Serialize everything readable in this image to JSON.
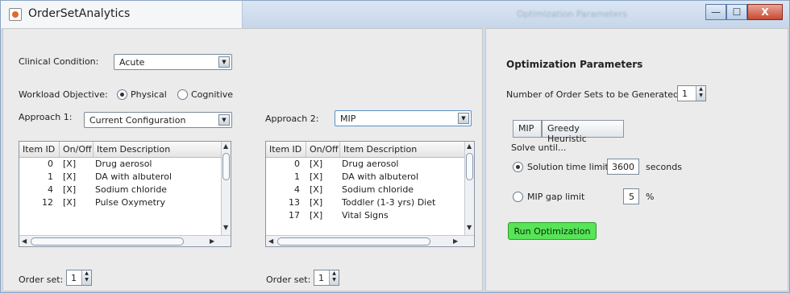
{
  "window": {
    "title": "OrderSetAnalytics",
    "blurred_title": "Optimization Parameters",
    "controls": [
      "—",
      "☐",
      "X"
    ]
  },
  "left": {
    "clinical_condition_label": "Clinical Condition:",
    "clinical_condition_value": "Acute",
    "workload_label": "Workload Objective:",
    "workload_options": [
      "Physical",
      "Cognitive"
    ],
    "workload_selected": "Physical",
    "approach1_label": "Approach 1:",
    "approach1_value": "Current Configuration",
    "approach2_label": "Approach 2:",
    "approach2_value": "MIP",
    "table_headers": [
      "Item ID",
      "On/Off",
      "Item Description"
    ],
    "table1_rows": [
      {
        "id": "0",
        "onoff": "[X]",
        "desc": "Drug aerosol"
      },
      {
        "id": "1",
        "onoff": "[X]",
        "desc": "DA with albuterol"
      },
      {
        "id": "4",
        "onoff": "[X]",
        "desc": "Sodium chloride"
      },
      {
        "id": "12",
        "onoff": "[X]",
        "desc": "Pulse Oxymetry"
      }
    ],
    "table2_rows": [
      {
        "id": "0",
        "onoff": "[X]",
        "desc": "Drug aerosol"
      },
      {
        "id": "1",
        "onoff": "[X]",
        "desc": "DA with albuterol"
      },
      {
        "id": "4",
        "onoff": "[X]",
        "desc": "Sodium chloride"
      },
      {
        "id": "13",
        "onoff": "[X]",
        "desc": "Toddler (1-3 yrs) Diet"
      },
      {
        "id": "17",
        "onoff": "[X]",
        "desc": "Vital Signs"
      }
    ],
    "order_set_label": "Order set:",
    "order_set1_value": "1",
    "order_set2_value": "1"
  },
  "right": {
    "heading": "Optimization Parameters",
    "num_sets_label": "Number of Order Sets to be Generated",
    "num_sets_value": "1",
    "tabs": [
      "MIP",
      "Greedy Heuristic"
    ],
    "solve_until": "Solve until...",
    "time_limit_label": "Solution time limit",
    "time_limit_value": "3600",
    "time_limit_unit": "seconds",
    "gap_label": "MIP gap limit",
    "gap_value": "5",
    "gap_unit": "%",
    "run_button": "Run Optimization",
    "run_button_color": "#57e457"
  }
}
